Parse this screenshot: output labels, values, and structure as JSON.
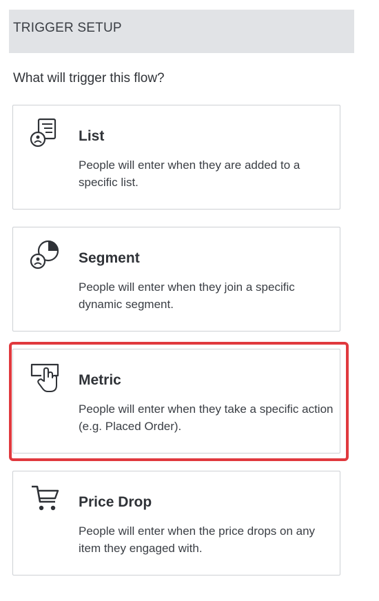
{
  "header": {
    "title": "TRIGGER SETUP"
  },
  "question": "What will trigger this flow?",
  "triggers": [
    {
      "title": "List",
      "description": "People will enter when they are added to a specific list.",
      "icon": "list-person-icon"
    },
    {
      "title": "Segment",
      "description": "People will enter when they join a specific dynamic segment.",
      "icon": "segment-pie-person-icon"
    },
    {
      "title": "Metric",
      "description": "People will enter when they take a specific action (e.g. Placed Order).",
      "icon": "click-hand-icon"
    },
    {
      "title": "Price Drop",
      "description": "People will enter when the price drops on any item they engaged with.",
      "icon": "shopping-cart-icon"
    }
  ],
  "colors": {
    "header_bg": "#e1e3e6",
    "card_border": "#cdd0d4",
    "highlight": "#e0393e",
    "text": "#2f3237"
  }
}
